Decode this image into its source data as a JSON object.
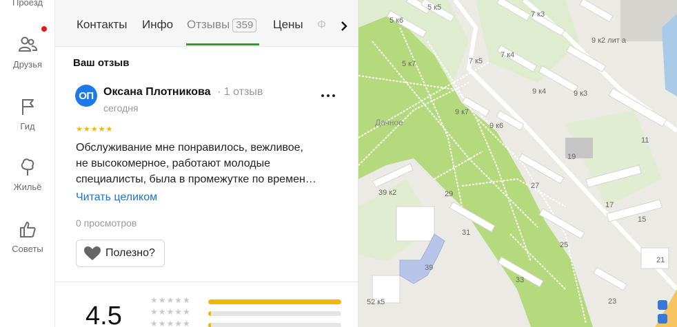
{
  "rail": {
    "top_label": "Проезд",
    "friends_label": "Друзья",
    "guide_label": "Гид",
    "housing_label": "Жильё",
    "tips_label": "Советы"
  },
  "tabs": [
    {
      "label": "Контакты"
    },
    {
      "label": "Инфо"
    },
    {
      "label": "Отзывы",
      "count": "359",
      "active": true
    },
    {
      "label": "Цены"
    },
    {
      "label": "Ф"
    }
  ],
  "your_review": {
    "title": "Ваш отзыв"
  },
  "review": {
    "avatar_initials": "ОП",
    "author": "Оксана Плотникова",
    "author_meta": "· 1 отзыв",
    "date": "сегодня",
    "stars": "★★★★★",
    "text_lines": [
      "Обслуживание мне понравилось, вежливое,",
      "не высокомерное, работают молодые",
      "специалисты, была в промежутке по времен…"
    ],
    "read_more": "Читать целиком",
    "views": "0 просмотров",
    "useful_label": "Полезно?"
  },
  "rating": {
    "value": "4.5",
    "bars": [
      {
        "stars": "★★★★★",
        "fraction": 1.0
      },
      {
        "stars": "★★★★★",
        "fraction": 0.02
      },
      {
        "stars": "★★★★★",
        "fraction": 0.02
      }
    ]
  },
  "map": {
    "labels": [
      "5 к5",
      "5 к6",
      "7 к3",
      "9 к2 лит а",
      "7 к4",
      "5 к7",
      "7 к5",
      "9 к4",
      "9 к3",
      "9 к7",
      "9 к6",
      "Дачное",
      "11",
      "19",
      "27",
      "17",
      "15",
      "39 к2",
      "29",
      "31",
      "25",
      "21",
      "39",
      "33",
      "52 к5",
      "23"
    ]
  },
  "colors": {
    "accent_green": "#24a12e",
    "link_blue": "#1a73d9",
    "star_gold": "#f6b500",
    "avatar_blue": "#1e78e6",
    "notification_red": "#e3161a"
  }
}
